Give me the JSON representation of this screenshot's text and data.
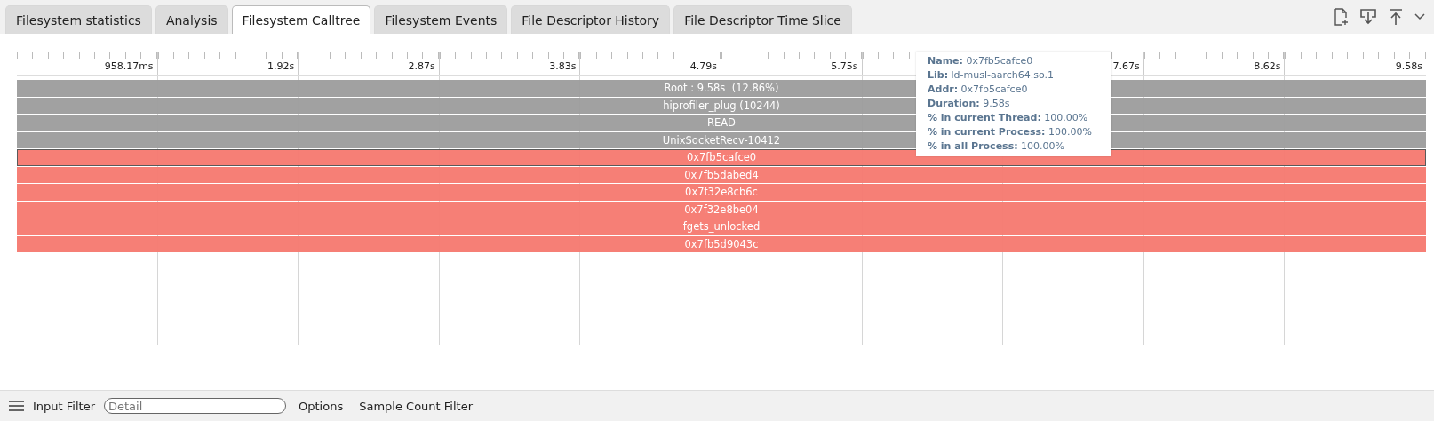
{
  "tabs": [
    {
      "label": "Filesystem statistics",
      "selected": false
    },
    {
      "label": "Analysis",
      "selected": false
    },
    {
      "label": "Filesystem Calltree",
      "selected": true
    },
    {
      "label": "Filesystem Events",
      "selected": false
    },
    {
      "label": "File Descriptor History",
      "selected": false
    },
    {
      "label": "File Descriptor Time Slice",
      "selected": false
    }
  ],
  "ruler": {
    "labels": [
      "958.17ms",
      "1.92s",
      "2.87s",
      "3.83s",
      "4.79s",
      "5.75s",
      "7.67s",
      "8.62s",
      "9.58s"
    ]
  },
  "frames": [
    {
      "label": "Root : 9.58s  (12.86%)",
      "color": "#9e9e9e",
      "selected": false
    },
    {
      "label": "hiprofiler_plug (10244)",
      "color": "#9e9e9e",
      "selected": false
    },
    {
      "label": "READ",
      "color": "#9e9e9e",
      "selected": false
    },
    {
      "label": "UnixSocketRecv-10412",
      "color": "#9e9e9e",
      "selected": false
    },
    {
      "label": "0x7fb5cafce0",
      "color": "#f67b72",
      "selected": true
    },
    {
      "label": "0x7fb5dabed4",
      "color": "#f67b72",
      "selected": false
    },
    {
      "label": "0x7f32e8cb6c",
      "color": "#f67b72",
      "selected": false
    },
    {
      "label": "0x7f32e8be04",
      "color": "#f67b72",
      "selected": false
    },
    {
      "label": "fgets_unlocked",
      "color": "#f67b72",
      "selected": false
    },
    {
      "label": "0x7fb5d9043c",
      "color": "#f67b72",
      "selected": false
    }
  ],
  "tooltip": [
    {
      "key": "Name:",
      "value": "0x7fb5cafce0"
    },
    {
      "key": "Lib:",
      "value": "ld-musl-aarch64.so.1"
    },
    {
      "key": "Addr:",
      "value": "0x7fb5cafce0"
    },
    {
      "key": "Duration:",
      "value": "9.58s"
    },
    {
      "key": "% in current Thread:",
      "value": "100.00%"
    },
    {
      "key": "% in current Process:",
      "value": "100.00%"
    },
    {
      "key": "% in all Process:",
      "value": "100.00%"
    }
  ],
  "footer": {
    "filter_label": "Input Filter",
    "filter_placeholder": "Detail",
    "options": "Options",
    "sample_filter": "Sample Count Filter"
  }
}
